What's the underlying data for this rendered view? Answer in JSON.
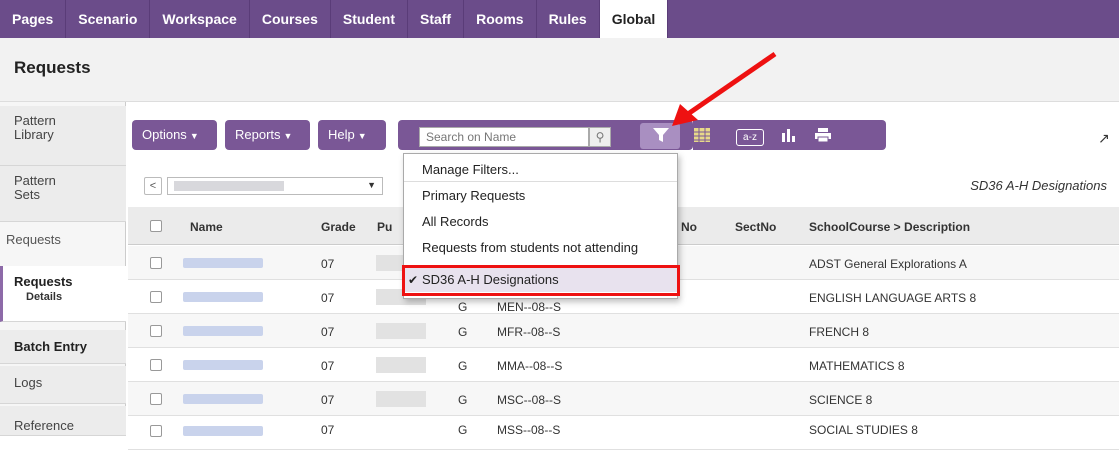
{
  "nav": {
    "tabs": [
      "Pages",
      "Scenario",
      "Workspace",
      "Courses",
      "Student",
      "Staff",
      "Rooms",
      "Rules",
      "Global"
    ],
    "active_tab": "Global"
  },
  "page_title": "Requests",
  "sidebar": {
    "items": [
      {
        "label": "Pattern\nLibrary"
      },
      {
        "label": "Pattern\nSets"
      },
      {
        "label": "Requests"
      },
      {
        "label": "Requests",
        "sub": "Details"
      },
      {
        "label": "Batch Entry"
      },
      {
        "label": "Logs"
      },
      {
        "label": "Reference"
      }
    ]
  },
  "toolbar": {
    "options_label": "Options",
    "reports_label": "Reports",
    "help_label": "Help",
    "search_placeholder": "Search on Name",
    "az_label": "a-z"
  },
  "recbar": {
    "filter_label": "SD36 A-H Designations"
  },
  "filter_menu": {
    "items": [
      "Manage Filters...",
      "Primary Requests",
      "All Records",
      "Requests from students not attending",
      "SD36 A-H Designations"
    ],
    "selected": "SD36 A-H Designations"
  },
  "table": {
    "headers": [
      "Name",
      "Grade",
      "Pu",
      "No",
      "SectNo",
      "SchoolCourse > Description"
    ],
    "rows": [
      {
        "grade": "07",
        "type": "",
        "course": "",
        "desc": "ADST General Explorations A"
      },
      {
        "grade": "07",
        "type": "G",
        "course": "MEN--08--S",
        "desc": "ENGLISH LANGUAGE ARTS 8"
      },
      {
        "grade": "07",
        "type": "G",
        "course": "MFR--08--S",
        "desc": "FRENCH 8"
      },
      {
        "grade": "07",
        "type": "G",
        "course": "MMA--08--S",
        "desc": "MATHEMATICS 8"
      },
      {
        "grade": "07",
        "type": "G",
        "course": "MSC--08--S",
        "desc": "SCIENCE 8"
      },
      {
        "grade": "07",
        "type": "G",
        "course": "MSS--08--S",
        "desc": "SOCIAL STUDIES 8"
      }
    ]
  },
  "colors": {
    "nav_bg": "#6b4c8a",
    "button_bg": "#7a5796",
    "highlight_red": "#ee1111"
  }
}
